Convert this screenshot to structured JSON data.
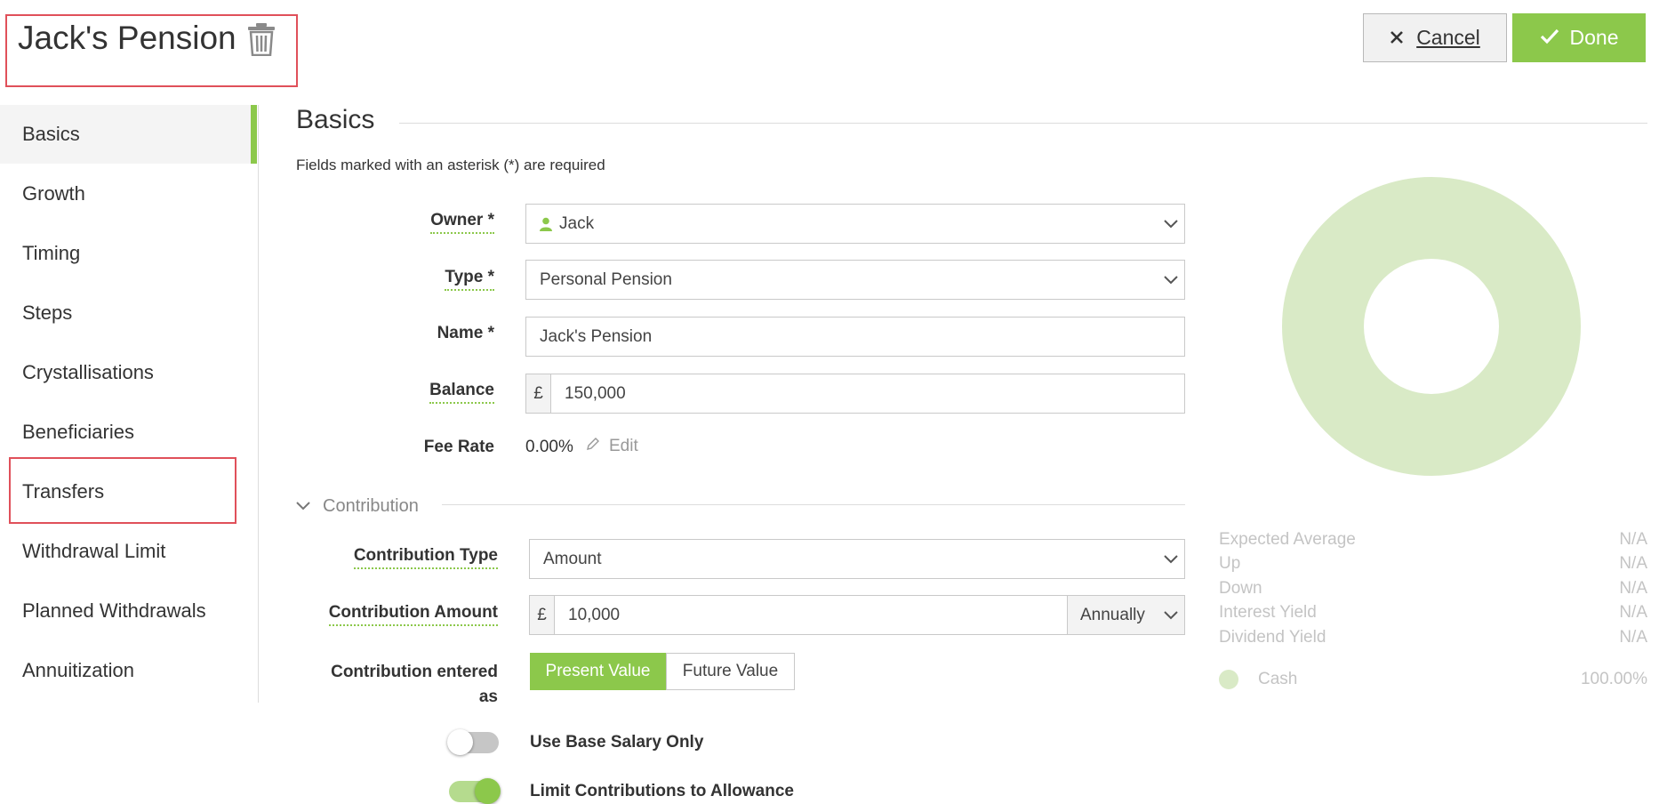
{
  "header": {
    "title": "Jack's Pension",
    "cancel_label": "Cancel",
    "done_label": "Done"
  },
  "sidebar": {
    "items": [
      {
        "label": "Basics",
        "active": true
      },
      {
        "label": "Growth"
      },
      {
        "label": "Timing"
      },
      {
        "label": "Steps"
      },
      {
        "label": "Crystallisations"
      },
      {
        "label": "Beneficiaries"
      },
      {
        "label": "Transfers",
        "highlighted": true
      },
      {
        "label": "Withdrawal Limit"
      },
      {
        "label": "Planned Withdrawals"
      },
      {
        "label": "Annuitization"
      }
    ]
  },
  "basics": {
    "section_title": "Basics",
    "required_note": "Fields marked with an asterisk (*) are required",
    "owner": {
      "label": "Owner *",
      "value": "Jack",
      "icon": "person-icon"
    },
    "type": {
      "label": "Type *",
      "value": "Personal Pension"
    },
    "name": {
      "label": "Name *",
      "value": "Jack's Pension"
    },
    "balance": {
      "label": "Balance",
      "currency": "£",
      "value": "150,000"
    },
    "fee_rate": {
      "label": "Fee Rate",
      "value": "0.00%",
      "edit_label": "Edit"
    }
  },
  "contribution": {
    "section_title": "Contribution",
    "type": {
      "label": "Contribution Type",
      "value": "Amount"
    },
    "amount": {
      "label": "Contribution Amount",
      "currency": "£",
      "value": "10,000",
      "frequency": "Annually"
    },
    "entered_as": {
      "label_line1": "Contribution entered",
      "label_line2": "as",
      "options": [
        "Present Value",
        "Future Value"
      ],
      "selected": "Present Value"
    },
    "base_salary_only": {
      "label": "Use Base Salary Only",
      "on": false
    },
    "limit_allowance": {
      "label": "Limit Contributions to Allowance",
      "on": true
    }
  },
  "allocation": {
    "stats": [
      {
        "label": "Expected Average",
        "value": "N/A"
      },
      {
        "label": "Up",
        "value": "N/A"
      },
      {
        "label": "Down",
        "value": "N/A"
      },
      {
        "label": "Interest Yield",
        "value": "N/A"
      },
      {
        "label": "Dividend Yield",
        "value": "N/A"
      }
    ],
    "legend": [
      {
        "label": "Cash",
        "value": "100.00%",
        "color": "#d9eac6"
      }
    ]
  },
  "chart_data": {
    "type": "pie",
    "categories": [
      "Cash"
    ],
    "values": [
      100
    ],
    "donut": true,
    "colors": [
      "#d9eac6"
    ]
  },
  "colors": {
    "accent": "#8cc84b",
    "highlight_border": "#e0505a",
    "donut": "#d9eac6"
  }
}
